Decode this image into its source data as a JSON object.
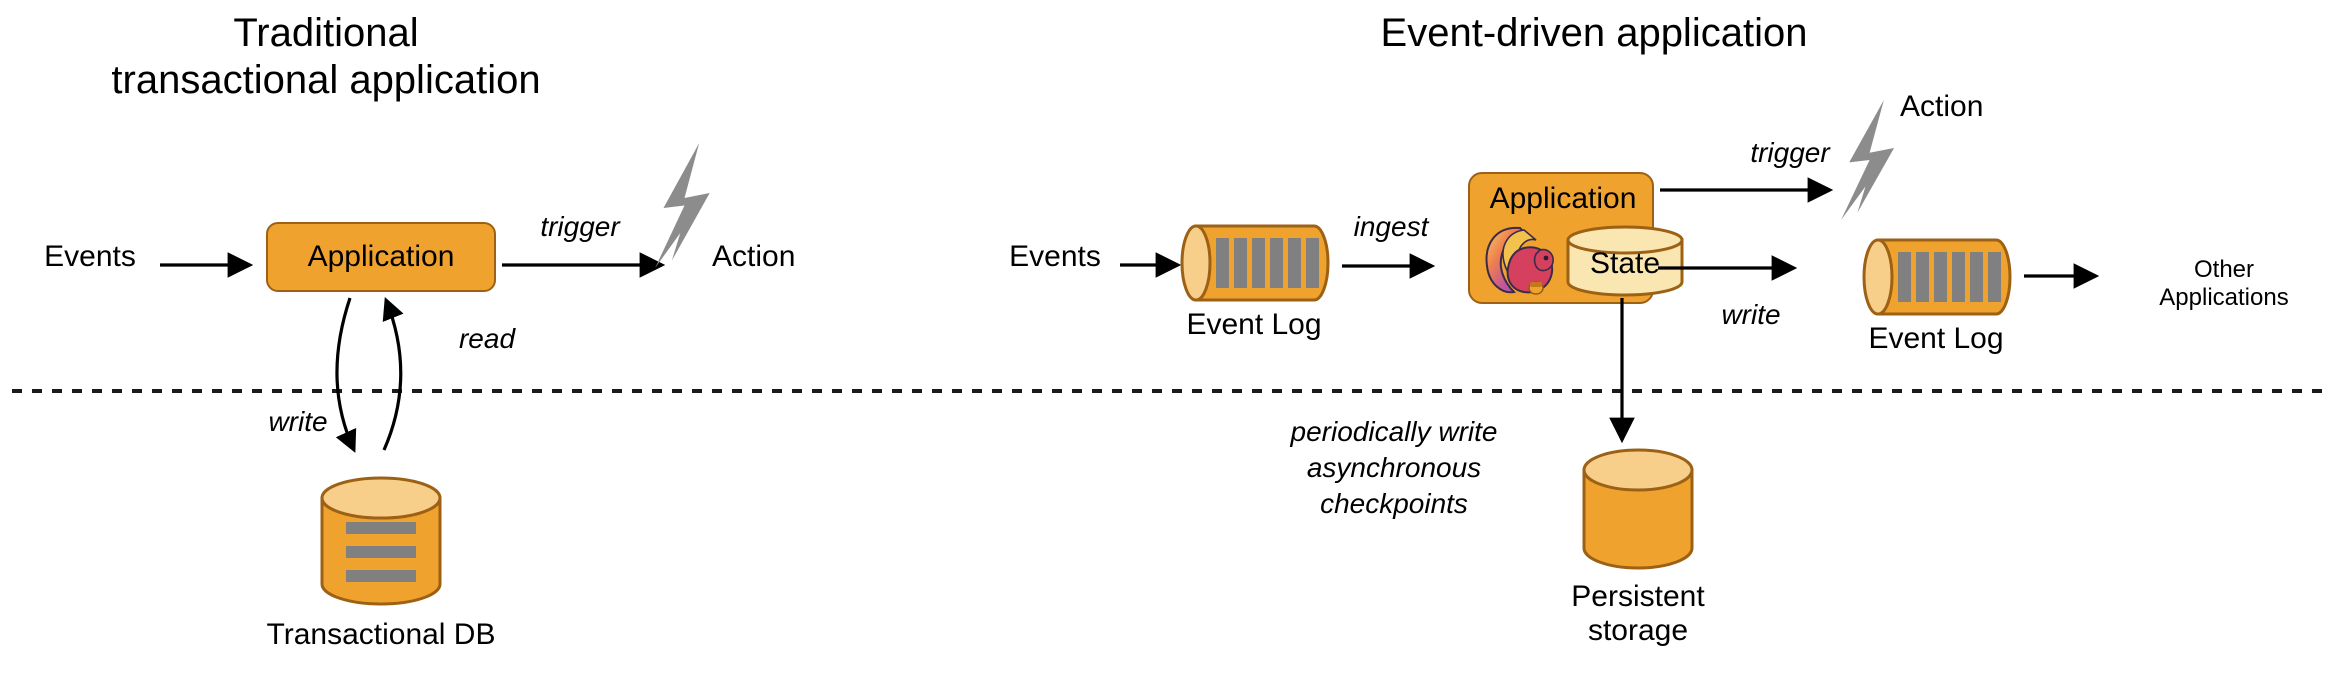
{
  "colors": {
    "orange_fill": "#F0A22E",
    "orange_stroke": "#9C6114",
    "cylinder_top": "#F8CE8B",
    "state_fill": "#FAE6B0",
    "bar_gray": "#808080",
    "bolt_gray": "#8C8C8C",
    "line_black": "#000000",
    "dashed_line": "#1A1A1A"
  },
  "left_panel": {
    "title": "Traditional\ntransactional application",
    "events_label": "Events",
    "application_label": "Application",
    "trigger_label": "trigger",
    "action_label": "Action",
    "read_label": "read",
    "write_label": "write",
    "db_label": "Transactional DB",
    "bolt_icon": "lightning-bolt-icon"
  },
  "right_panel": {
    "title": "Event-driven application",
    "events_label": "Events",
    "event_log_in_label": "Event Log",
    "ingest_label": "ingest",
    "application_label": "Application",
    "flink_logo": "flink-squirrel-icon",
    "state_label": "State",
    "trigger_label": "trigger",
    "action_label": "Action",
    "bolt_icon": "lightning-bolt-icon",
    "write_label": "write",
    "event_log_out_label": "Event Log",
    "other_apps_label": "Other\nApplications",
    "checkpoints_label": "periodically write\nasynchronous\ncheckpoints",
    "persistent_storage_label": "Persistent\nstorage"
  },
  "divider": {
    "name": "dashed-divider",
    "style": "dashed"
  }
}
